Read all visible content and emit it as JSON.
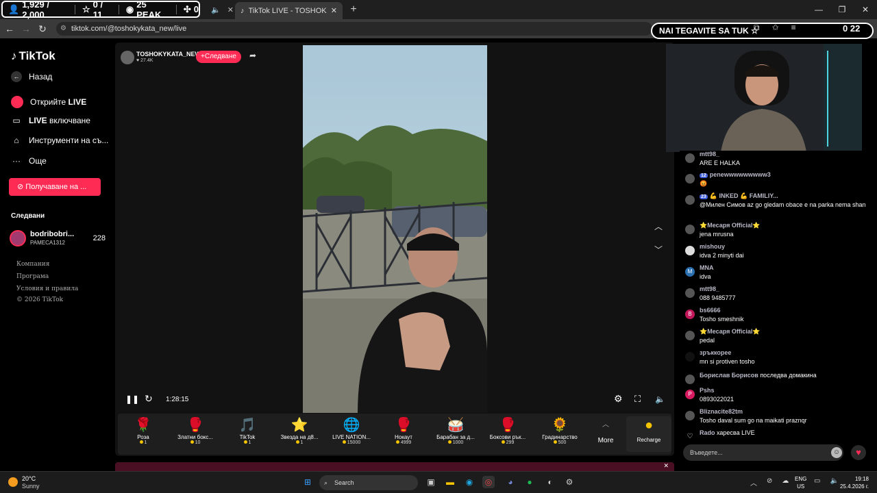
{
  "stats": {
    "viewers": "1,929 / 2,000",
    "stars": "0 / 11",
    "peak": "25 PEAK",
    "other": "0"
  },
  "tabs": {
    "active_title": "TikTok LIVE - TOSHOKYKATA",
    "new_tab": "+"
  },
  "address": {
    "url": "tiktok.com/@toshokykata_new/live"
  },
  "overlay": {
    "title": "NAI TEGAVITE SA TUK",
    "counter": "0 22"
  },
  "sidebar": {
    "logo": "TikTok",
    "back": "Назад",
    "discover_pre": "Открийте ",
    "discover_bold": "LIVE",
    "live_on_bold": "LIVE",
    "live_on_post": " включване",
    "creator_tools": "Инструменти на съ...",
    "more": "Още",
    "get_button": "Получаване на ...",
    "following_header": "Следвани",
    "follow_user": {
      "name": "bodribobri...",
      "sub": "PAMECA1312",
      "count": "228"
    },
    "footer": [
      "Компания",
      "Програма",
      "Условия и правила",
      "© 2026 TikTok"
    ]
  },
  "host": {
    "name": "TOSHOKYKATA_NEW",
    "likes": "27.4K",
    "follow": "+Следване"
  },
  "player": {
    "time": "1:28:15"
  },
  "gifts": [
    {
      "name": "Роза",
      "price": "1",
      "icon": "🌹"
    },
    {
      "name": "Златни бокс...",
      "price": "10",
      "icon": "🥊"
    },
    {
      "name": "TikTok",
      "price": "1",
      "icon": "🎵"
    },
    {
      "name": "Звезда на д8...",
      "price": "1",
      "icon": "⭐"
    },
    {
      "name": "LIVE NATION...",
      "price": "15000",
      "icon": "🌐"
    },
    {
      "name": "Нокаут",
      "price": "4999",
      "icon": "🥊"
    },
    {
      "name": "Барабан за д...",
      "price": "1000",
      "icon": "🥁"
    },
    {
      "name": "Боксови рък...",
      "price": "299",
      "icon": "🥊"
    },
    {
      "name": "Градинарство",
      "price": "500",
      "icon": "🌻"
    }
  ],
  "gift_more": "More",
  "gift_recharge": "Recharge",
  "chat": {
    "messages": [
      {
        "user": "mtt98_",
        "text": "ARE E HALKA",
        "badge": ""
      },
      {
        "user": "penewwwwwwwww3",
        "text": "😡",
        "badge": "12"
      },
      {
        "user": "💪 INKED 💪 FAMILIY...",
        "text": "@Милен Симов az go gledam obace e na parka nema shan",
        "badge": "23"
      },
      {
        "user": "⭐Месаря Official⭐",
        "text": "jena mrusna",
        "badge": ""
      },
      {
        "user": "mishouy",
        "text": "idva 2 minyti dai",
        "badge": ""
      },
      {
        "user": "MNA",
        "text": "idva",
        "badge": ""
      },
      {
        "user": "mtt98_",
        "text": "088 9485777",
        "badge": ""
      },
      {
        "user": "bs6666",
        "text": "Tosho smeshnik",
        "badge": ""
      },
      {
        "user": "⭐Месаря Official⭐",
        "text": "pedal",
        "badge": ""
      },
      {
        "user": "зръккорее",
        "text": "mn si protiven tosho",
        "badge": ""
      },
      {
        "user": "Борислав Борисов",
        "text": "",
        "badge": "",
        "inline": "последва домакина"
      },
      {
        "user": "Pshs",
        "text": "0893022021",
        "badge": ""
      },
      {
        "user": "Bliznacite82tm",
        "text": "Tosho daval sum go na maikati praznqr",
        "badge": ""
      },
      {
        "user": "Rado",
        "text": "",
        "badge": "",
        "inline": "харесва LIVE"
      }
    ],
    "input_placeholder": "Въведете..."
  },
  "taskbar": {
    "temp": "20°C",
    "weather": "Sunny",
    "search": "Search",
    "lang1": "ENG",
    "lang2": "US",
    "time": "19:18",
    "date": "25.4.2026 г."
  },
  "colors": {
    "accent": "#fe2c55",
    "bg": "#000000",
    "panel": "#121212"
  }
}
